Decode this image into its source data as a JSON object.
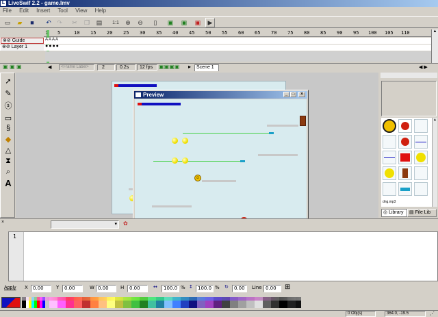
{
  "window": {
    "title": "LiveSwif 2.2 - game.lmv"
  },
  "menu": [
    "File",
    "Edit",
    "Insert",
    "Tool",
    "View",
    "Help"
  ],
  "ruler": [
    "1",
    "5",
    "10",
    "15",
    "20",
    "25",
    "30",
    "35",
    "40",
    "45",
    "50",
    "55",
    "60",
    "65",
    "70",
    "75",
    "80",
    "85",
    "90",
    "95",
    "100",
    "105",
    "110"
  ],
  "layers": [
    {
      "name": "Guide"
    },
    {
      "name": "Layer 1"
    }
  ],
  "keyframes_text": "A A A A",
  "statusbar": {
    "frame_label_placeholder": "<Frame Label>",
    "frame": "2",
    "time": "0.2s",
    "fps": "12 fps",
    "scene": "Scene 1"
  },
  "preview": {
    "title": "Preview"
  },
  "library": {
    "tab_library": "Library",
    "tab_filelib": "File Lib",
    "item_label": "dng.mp3"
  },
  "editor": {
    "line_number": "1"
  },
  "properties": {
    "apply": "Apply",
    "x_label": "X",
    "x": "0.00",
    "y_label": "Y",
    "y": "0.00",
    "w_label": "W",
    "w": "0.00",
    "h_label": "H",
    "h": "0.00",
    "scale_w": "100.0",
    "pct1": "%",
    "scale_h": "100.0",
    "pct2": "%",
    "rotation": "0.00",
    "line_label": "Line",
    "line": "0.00"
  },
  "status": {
    "objects": "0 Obj(s)",
    "coords": "364.0, -19.5"
  },
  "colors": {
    "accent": "#0a246a",
    "preview_bg": "#d8ebef",
    "player_bar": "#1010c0",
    "door": "#8b3a10",
    "platform_teal": "#1aa0c8"
  }
}
